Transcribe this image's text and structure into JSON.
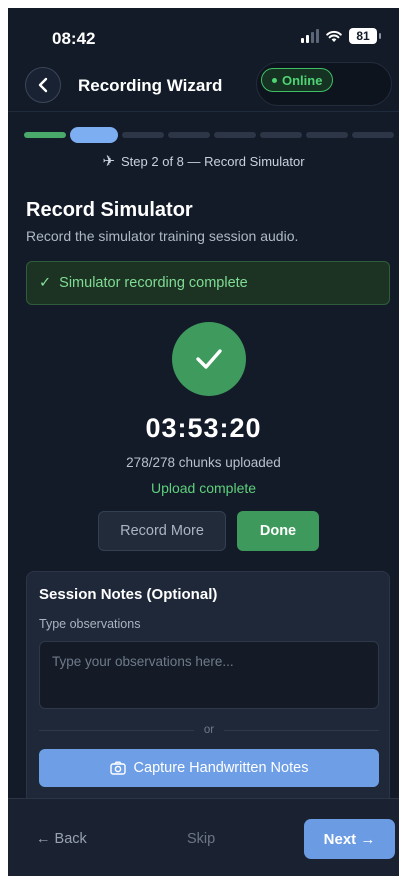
{
  "status_bar": {
    "time": "08:42",
    "battery": "81",
    "icons": [
      "signal-icon",
      "wifi-icon",
      "battery-icon"
    ]
  },
  "header": {
    "back_icon": "chevron-left-icon",
    "title": "Recording Wizard",
    "status_badge": "Online"
  },
  "progress": {
    "total_steps": 8,
    "current_step": 2,
    "step_icon": "airplane-icon",
    "step_label": "Step 2 of 8 — Record Simulator"
  },
  "main": {
    "title": "Record Simulator",
    "subtitle": "Record the simulator training session audio.",
    "banner": {
      "check": "✓",
      "text": "Simulator recording complete"
    },
    "complete_icon": "checkmark-icon",
    "timer": "03:53:20",
    "chunks": "278/278 chunks uploaded",
    "upload_status": "Upload complete",
    "record_more_label": "Record More",
    "done_label": "Done"
  },
  "notes": {
    "title": "Session Notes (Optional)",
    "label": "Type observations",
    "placeholder": "Type your observations here...",
    "value": "",
    "or_text": "or",
    "capture_icon": "camera-icon",
    "capture_label": "Capture Handwritten Notes"
  },
  "footer": {
    "back_label": "← Back",
    "skip_label": "Skip",
    "next_label": "Next →"
  },
  "colors": {
    "background": "#131b28",
    "success": "#3f9a5d",
    "accent_blue": "#6b9be3",
    "online_green": "#4fd474"
  }
}
